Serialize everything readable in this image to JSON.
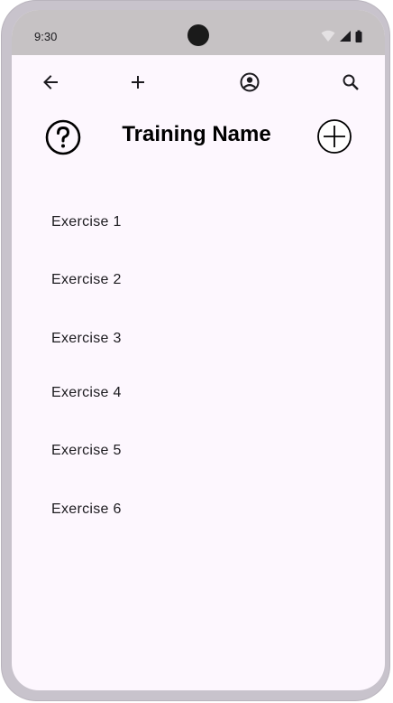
{
  "status_bar": {
    "time": "9:30",
    "icons": [
      "wifi-icon",
      "cellular-signal-icon",
      "battery-icon"
    ]
  },
  "top_bar": {
    "icons": [
      "arrow-back-icon",
      "add-icon",
      "account-circle-icon",
      "search-icon"
    ]
  },
  "header": {
    "title": "Training Name",
    "help_icon": "help-circle-icon",
    "add_icon": "add-circle-icon"
  },
  "exercises": [
    {
      "label": "Exercise 1"
    },
    {
      "label": "Exercise 2"
    },
    {
      "label": "Exercise 3"
    },
    {
      "label": "Exercise 4"
    },
    {
      "label": "Exercise 5"
    },
    {
      "label": "Exercise 6"
    }
  ],
  "colors": {
    "screen_background": "#fdf7fe",
    "status_bar_background": "#c6c2c4",
    "frame": "#c8c3cc",
    "text": "#1c1b1f"
  }
}
